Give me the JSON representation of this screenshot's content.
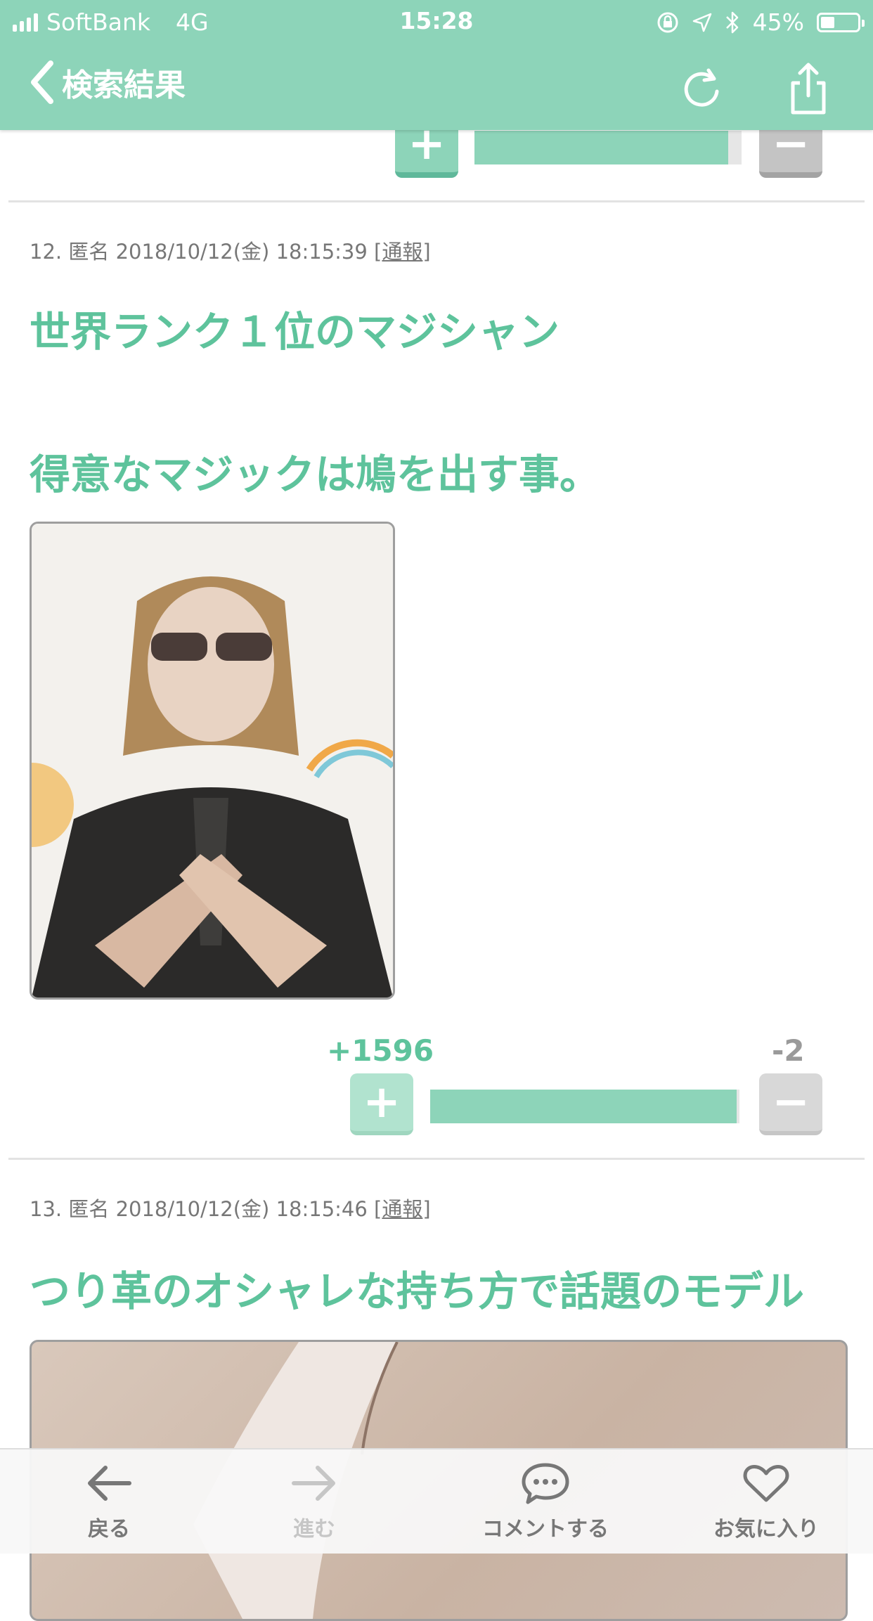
{
  "status_bar": {
    "carrier": "SoftBank",
    "network": "4G",
    "time": "15:28",
    "battery": "45%",
    "battery_level": 0.45
  },
  "nav": {
    "back_label": "検索結果",
    "refresh_icon": "refresh-icon",
    "share_icon": "share-icon"
  },
  "colors": {
    "accent": "#8dd4b9",
    "accent_text": "#5ec39c",
    "minus_gray": "#c4c4c4"
  },
  "comments": [
    {
      "number": "12.",
      "author": "匿名",
      "timestamp": "2018/10/12(金) 18:15:39",
      "report_label": "通報",
      "lines": [
        "世界ランク１位のマジシャン",
        "",
        "得意なマジックは鳩を出す事。"
      ],
      "image_alt": "photo",
      "plus_count": "+1596",
      "minus_count": "-2",
      "plus_ratio": 0.99
    },
    {
      "number": "13.",
      "author": "匿名",
      "timestamp": "2018/10/12(金) 18:15:46",
      "report_label": "通報",
      "lines": [
        "つり革のオシャレな持ち方で話題のモデル"
      ],
      "image_alt": "photo"
    }
  ],
  "previous_vote": {
    "plus_ratio": 0.95
  },
  "toolbar": {
    "back": "戻る",
    "forward": "進む",
    "comment": "コメントする",
    "favorite": "お気に入り"
  }
}
